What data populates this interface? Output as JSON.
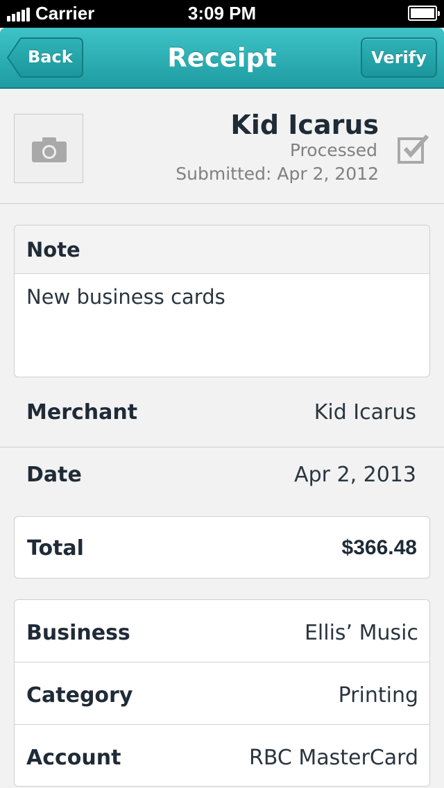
{
  "status_bar": {
    "carrier": "Carrier",
    "time": "3:09 PM",
    "icons": [
      "signal-icon",
      "battery-icon"
    ]
  },
  "nav": {
    "title": "Receipt",
    "back_label": "Back",
    "verify_label": "Verify",
    "color": "#2cb3b7"
  },
  "header": {
    "name": "Kid Icarus",
    "status": "Processed",
    "submitted": "Submitted: Apr 2, 2012",
    "icons": [
      "camera-icon",
      "checkbox-checked-icon"
    ]
  },
  "note": {
    "heading": "Note",
    "text": "New business cards"
  },
  "merchant": {
    "label": "Merchant",
    "value": "Kid Icarus"
  },
  "date": {
    "label": "Date",
    "value": "Apr 2, 2013"
  },
  "total": {
    "label": "Total",
    "value": "$366.48"
  },
  "details": [
    {
      "label": "Business",
      "value": "Ellis’ Music"
    },
    {
      "label": "Category",
      "value": "Printing"
    },
    {
      "label": "Account",
      "value": "RBC MasterCard"
    }
  ]
}
